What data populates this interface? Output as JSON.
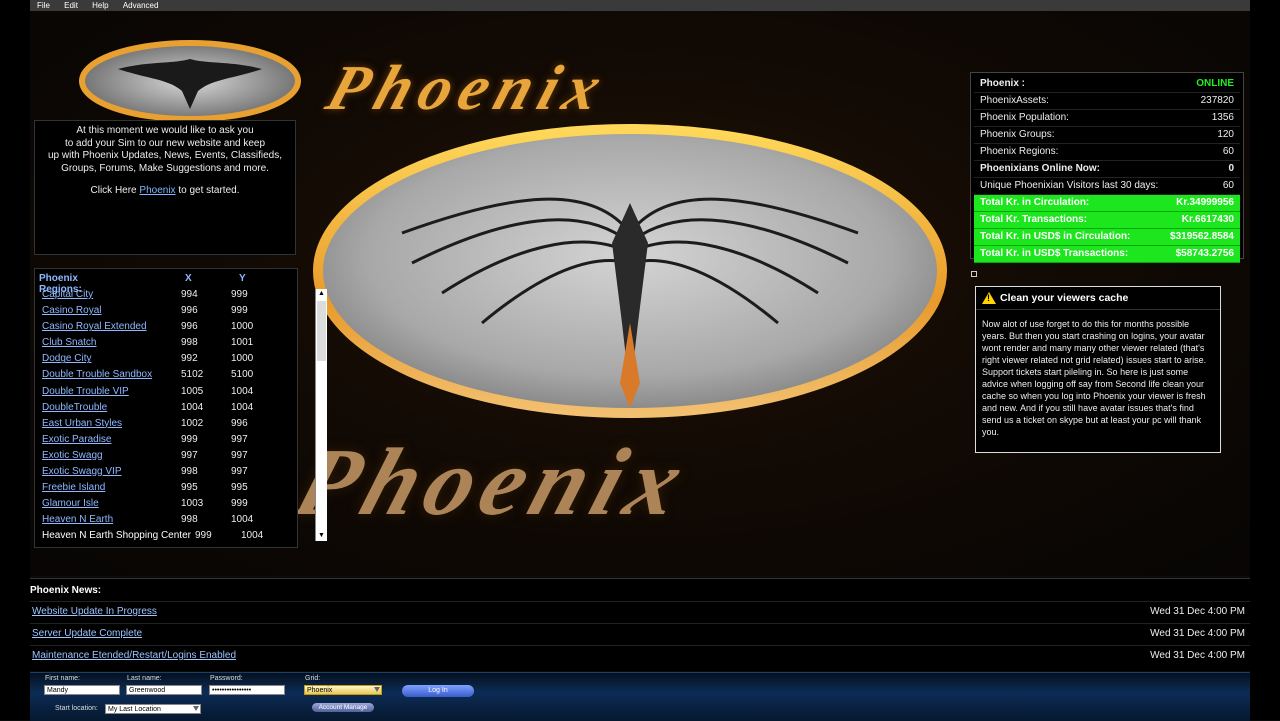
{
  "menu": [
    "File",
    "Edit",
    "Help",
    "Advanced"
  ],
  "logo": {
    "top_text": "Phoenix",
    "bottom_text": "Phoenix"
  },
  "intro": {
    "line1": "At this moment we would like to ask you",
    "line2": "to add your Sim to our new website and keep",
    "line3": "up with Phoenix Updates, News, Events, Classifieds,",
    "line4": "Groups, Forums, Make Suggestions and more.",
    "click_prefix": "Click Here",
    "link": "Phoenix",
    "click_suffix": "to get started."
  },
  "regions": {
    "header": "Phoenix Regions:",
    "col_x": "X",
    "col_y": "Y",
    "rows": [
      {
        "name": "Capital City",
        "x": "994",
        "y": "999"
      },
      {
        "name": "Casino Royal",
        "x": "996",
        "y": "999"
      },
      {
        "name": "Casino Royal Extended",
        "x": "996",
        "y": "1000"
      },
      {
        "name": "Club Snatch",
        "x": "998",
        "y": "1001"
      },
      {
        "name": "Dodge City",
        "x": "992",
        "y": "1000"
      },
      {
        "name": "Double Trouble Sandbox",
        "x": "5102",
        "y": "5100"
      },
      {
        "name": "Double Trouble VIP",
        "x": "1005",
        "y": "1004"
      },
      {
        "name": "DoubleTrouble",
        "x": "1004",
        "y": "1004"
      },
      {
        "name": "East Urban Styles",
        "x": "1002",
        "y": "996"
      },
      {
        "name": "Exotic Paradise",
        "x": "999",
        "y": "997"
      },
      {
        "name": "Exotic Swagg",
        "x": "997",
        "y": "997"
      },
      {
        "name": "Exotic Swagg VIP",
        "x": "998",
        "y": "997"
      },
      {
        "name": "Freebie Island",
        "x": "995",
        "y": "995"
      },
      {
        "name": "Glamour Isle",
        "x": "1003",
        "y": "999"
      },
      {
        "name": "Heaven N Earth",
        "x": "998",
        "y": "1004"
      },
      {
        "name": "Heaven N Earth Shopping Center",
        "x": "999",
        "y": "1004"
      }
    ]
  },
  "stats": {
    "title": "Phoenix :",
    "status": "ONLINE",
    "rows": [
      {
        "label": "PhoenixAssets:",
        "value": "237820"
      },
      {
        "label": "Phoenix Population:",
        "value": "1356"
      },
      {
        "label": "Phoenix Groups:",
        "value": "120"
      },
      {
        "label": "Phoenix Regions:",
        "value": "60"
      },
      {
        "label": "Phoenixians Online Now:",
        "value": "0"
      },
      {
        "label": "Unique Phoenixian Visitors last 30 days:",
        "value": "60"
      }
    ],
    "money": [
      {
        "label": "Total Kr. in Circulation:",
        "value": "Kr.34999956"
      },
      {
        "label": "Total Kr. Transactions:",
        "value": "Kr.6617430"
      },
      {
        "label": "Total Kr. in USD$ in Circulation:",
        "value": "$319562.8584"
      },
      {
        "label": "Total Kr. in USD$ Transactions:",
        "value": "$58743.2756"
      }
    ]
  },
  "cache": {
    "title": "Clean your viewers cache",
    "body": "Now alot of use forget to do this for months possible years. But then you start crashing on logins, your avatar wont render and many many other viewer related (that's right viewer related not grid related) issues start to arise. Support tickets start pileling in. So here is just some advice when logging off say from Second life clean your cache so when you log into Phoenix your viewer is fresh and new. And if you still have avatar issues that's find send us a ticket on skype but at least your pc will thank you."
  },
  "news": {
    "header": "Phoenix News:",
    "items": [
      {
        "title": "Website Update In Progress",
        "date": "Wed 31 Dec 4:00 PM"
      },
      {
        "title": "Server Update Complete",
        "date": "Wed 31 Dec 4:00 PM"
      },
      {
        "title": "Maintenance Etended/Restart/Logins Enabled",
        "date": "Wed 31 Dec 4:00 PM"
      }
    ]
  },
  "login": {
    "first_label": "First name:",
    "first_value": "Mandy",
    "last_label": "Last name:",
    "last_value": "Greenwood",
    "password_label": "Password:",
    "password_value": "••••••••••••••••",
    "grid_label": "Grid:",
    "grid_value": "Phoenix",
    "start_label": "Start location:",
    "start_value": "My Last Location",
    "login_button": "Log In",
    "account_button": "Account Manage"
  }
}
